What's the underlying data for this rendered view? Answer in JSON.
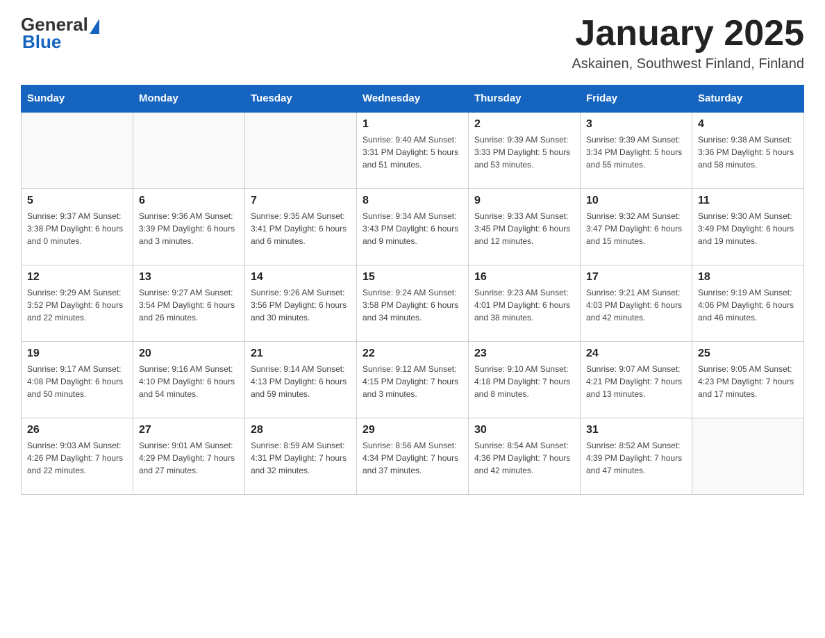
{
  "header": {
    "logo_general": "General",
    "logo_blue": "Blue",
    "title": "January 2025",
    "subtitle": "Askainen, Southwest Finland, Finland"
  },
  "columns": [
    "Sunday",
    "Monday",
    "Tuesday",
    "Wednesday",
    "Thursday",
    "Friday",
    "Saturday"
  ],
  "weeks": [
    [
      {
        "day": "",
        "info": ""
      },
      {
        "day": "",
        "info": ""
      },
      {
        "day": "",
        "info": ""
      },
      {
        "day": "1",
        "info": "Sunrise: 9:40 AM\nSunset: 3:31 PM\nDaylight: 5 hours\nand 51 minutes."
      },
      {
        "day": "2",
        "info": "Sunrise: 9:39 AM\nSunset: 3:33 PM\nDaylight: 5 hours\nand 53 minutes."
      },
      {
        "day": "3",
        "info": "Sunrise: 9:39 AM\nSunset: 3:34 PM\nDaylight: 5 hours\nand 55 minutes."
      },
      {
        "day": "4",
        "info": "Sunrise: 9:38 AM\nSunset: 3:36 PM\nDaylight: 5 hours\nand 58 minutes."
      }
    ],
    [
      {
        "day": "5",
        "info": "Sunrise: 9:37 AM\nSunset: 3:38 PM\nDaylight: 6 hours\nand 0 minutes."
      },
      {
        "day": "6",
        "info": "Sunrise: 9:36 AM\nSunset: 3:39 PM\nDaylight: 6 hours\nand 3 minutes."
      },
      {
        "day": "7",
        "info": "Sunrise: 9:35 AM\nSunset: 3:41 PM\nDaylight: 6 hours\nand 6 minutes."
      },
      {
        "day": "8",
        "info": "Sunrise: 9:34 AM\nSunset: 3:43 PM\nDaylight: 6 hours\nand 9 minutes."
      },
      {
        "day": "9",
        "info": "Sunrise: 9:33 AM\nSunset: 3:45 PM\nDaylight: 6 hours\nand 12 minutes."
      },
      {
        "day": "10",
        "info": "Sunrise: 9:32 AM\nSunset: 3:47 PM\nDaylight: 6 hours\nand 15 minutes."
      },
      {
        "day": "11",
        "info": "Sunrise: 9:30 AM\nSunset: 3:49 PM\nDaylight: 6 hours\nand 19 minutes."
      }
    ],
    [
      {
        "day": "12",
        "info": "Sunrise: 9:29 AM\nSunset: 3:52 PM\nDaylight: 6 hours\nand 22 minutes."
      },
      {
        "day": "13",
        "info": "Sunrise: 9:27 AM\nSunset: 3:54 PM\nDaylight: 6 hours\nand 26 minutes."
      },
      {
        "day": "14",
        "info": "Sunrise: 9:26 AM\nSunset: 3:56 PM\nDaylight: 6 hours\nand 30 minutes."
      },
      {
        "day": "15",
        "info": "Sunrise: 9:24 AM\nSunset: 3:58 PM\nDaylight: 6 hours\nand 34 minutes."
      },
      {
        "day": "16",
        "info": "Sunrise: 9:23 AM\nSunset: 4:01 PM\nDaylight: 6 hours\nand 38 minutes."
      },
      {
        "day": "17",
        "info": "Sunrise: 9:21 AM\nSunset: 4:03 PM\nDaylight: 6 hours\nand 42 minutes."
      },
      {
        "day": "18",
        "info": "Sunrise: 9:19 AM\nSunset: 4:06 PM\nDaylight: 6 hours\nand 46 minutes."
      }
    ],
    [
      {
        "day": "19",
        "info": "Sunrise: 9:17 AM\nSunset: 4:08 PM\nDaylight: 6 hours\nand 50 minutes."
      },
      {
        "day": "20",
        "info": "Sunrise: 9:16 AM\nSunset: 4:10 PM\nDaylight: 6 hours\nand 54 minutes."
      },
      {
        "day": "21",
        "info": "Sunrise: 9:14 AM\nSunset: 4:13 PM\nDaylight: 6 hours\nand 59 minutes."
      },
      {
        "day": "22",
        "info": "Sunrise: 9:12 AM\nSunset: 4:15 PM\nDaylight: 7 hours\nand 3 minutes."
      },
      {
        "day": "23",
        "info": "Sunrise: 9:10 AM\nSunset: 4:18 PM\nDaylight: 7 hours\nand 8 minutes."
      },
      {
        "day": "24",
        "info": "Sunrise: 9:07 AM\nSunset: 4:21 PM\nDaylight: 7 hours\nand 13 minutes."
      },
      {
        "day": "25",
        "info": "Sunrise: 9:05 AM\nSunset: 4:23 PM\nDaylight: 7 hours\nand 17 minutes."
      }
    ],
    [
      {
        "day": "26",
        "info": "Sunrise: 9:03 AM\nSunset: 4:26 PM\nDaylight: 7 hours\nand 22 minutes."
      },
      {
        "day": "27",
        "info": "Sunrise: 9:01 AM\nSunset: 4:29 PM\nDaylight: 7 hours\nand 27 minutes."
      },
      {
        "day": "28",
        "info": "Sunrise: 8:59 AM\nSunset: 4:31 PM\nDaylight: 7 hours\nand 32 minutes."
      },
      {
        "day": "29",
        "info": "Sunrise: 8:56 AM\nSunset: 4:34 PM\nDaylight: 7 hours\nand 37 minutes."
      },
      {
        "day": "30",
        "info": "Sunrise: 8:54 AM\nSunset: 4:36 PM\nDaylight: 7 hours\nand 42 minutes."
      },
      {
        "day": "31",
        "info": "Sunrise: 8:52 AM\nSunset: 4:39 PM\nDaylight: 7 hours\nand 47 minutes."
      },
      {
        "day": "",
        "info": ""
      }
    ]
  ]
}
